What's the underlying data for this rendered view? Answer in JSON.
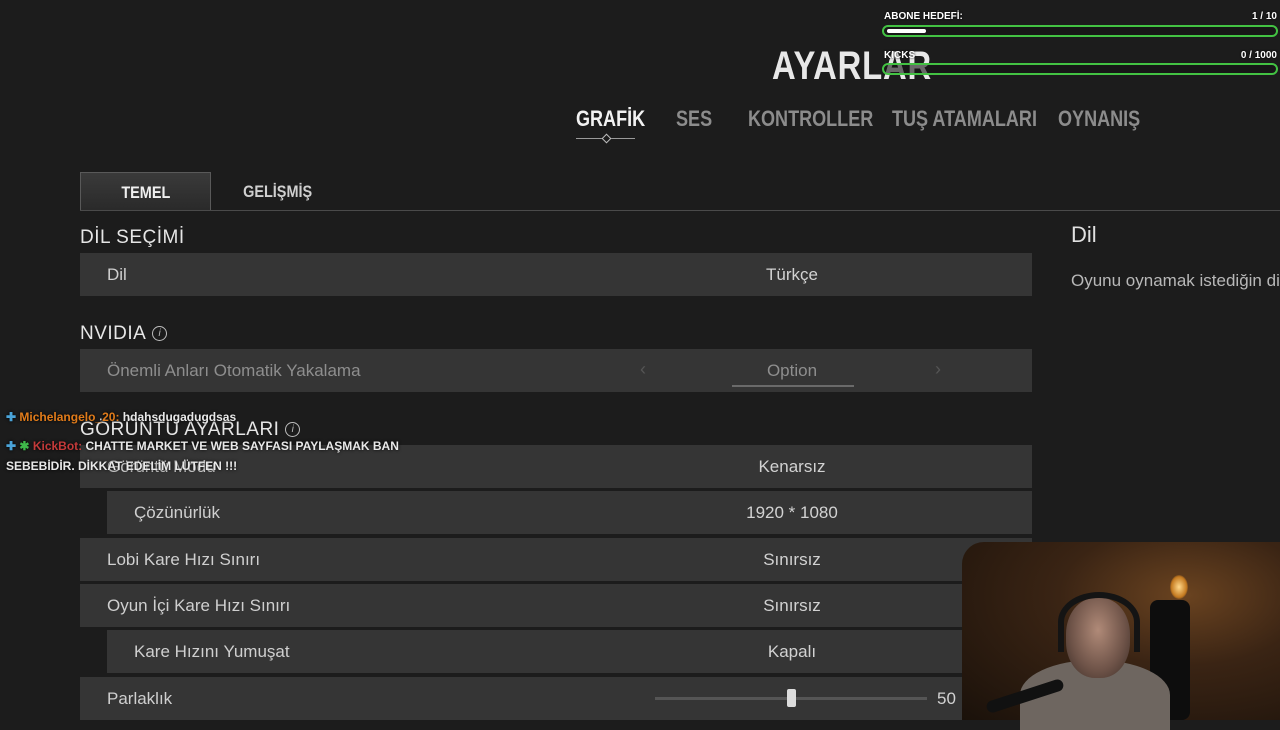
{
  "header": {
    "title": "AYARLAR",
    "tabs": [
      {
        "label": "GRAFİK",
        "active": true
      },
      {
        "label": "SES",
        "active": false
      },
      {
        "label": "KONTROLLER",
        "active": false
      },
      {
        "label": "TUŞ ATAMALARI",
        "active": false
      },
      {
        "label": "OYNANIŞ",
        "active": false
      }
    ]
  },
  "subtabs": [
    {
      "label": "TEMEL",
      "active": true
    },
    {
      "label": "GELİŞMİŞ",
      "active": false
    }
  ],
  "sections": {
    "language": {
      "title": "DİL SEÇİMİ",
      "rows": [
        {
          "label": "Dil",
          "value": "Türkçe"
        }
      ]
    },
    "nvidia": {
      "title": "NVIDIA",
      "rows": [
        {
          "label": "Önemli Anları Otomatik Yakalama",
          "value": "Option"
        }
      ]
    },
    "display": {
      "title": "GÖRÜNTÜ AYARLARI",
      "rows": [
        {
          "label": "Görüntü Modu",
          "value": "Kenarsız"
        },
        {
          "label": "Çözünürlük",
          "value": "1920 * 1080"
        },
        {
          "label": "Lobi Kare Hızı Sınırı",
          "value": "Sınırsız"
        },
        {
          "label": "Oyun İçi Kare Hızı Sınırı",
          "value": "Sınırsız"
        },
        {
          "label": "Kare Hızını Yumuşat",
          "value": "Kapalı"
        },
        {
          "label": "Parlaklık",
          "value": "50",
          "slider_fraction": 0.5
        }
      ]
    }
  },
  "info_panel": {
    "title": "Dil",
    "description": "Oyunu oynamak istediğin dili"
  },
  "stream_overlay": {
    "goals": [
      {
        "label": "ABONE HEDEFİ:",
        "progress": "1  / 10",
        "fraction": 0.1
      },
      {
        "label": "KICKS",
        "progress": "0  / 1000",
        "fraction": 0.0
      }
    ],
    "chat": [
      {
        "user": "Michelangelo_20:",
        "message": "hdahsdugadugdsas"
      },
      {
        "user": "KickBot:",
        "message": "CHATTE MARKET VE WEB SAYFASI PAYLAŞMAK BAN SEBEBİDİR. DİKKAT EDELİM LÜTFEN !!!"
      }
    ]
  },
  "colors": {
    "background": "#1c1c1c",
    "row": "#353535",
    "goal_bar": "#43c243",
    "chat_user1": "#e07b1a",
    "chat_user2": "#c43a3a"
  }
}
